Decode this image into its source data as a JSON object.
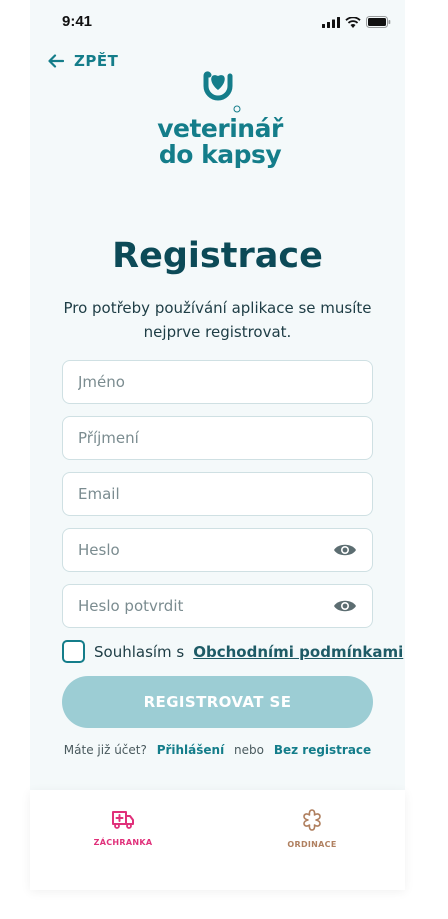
{
  "status_bar": {
    "time": "9:41"
  },
  "nav": {
    "back_label": "ZPĚT"
  },
  "logo": {
    "line1": "veterinář",
    "line2": "do kapsy"
  },
  "header": {
    "title": "Registrace",
    "subtitle": "Pro potřeby používání aplikace se musíte nejprve registrovat."
  },
  "form": {
    "first_name_placeholder": "Jméno",
    "last_name_placeholder": "Příjmení",
    "email_placeholder": "Email",
    "password_placeholder": "Heslo",
    "password_confirm_placeholder": "Heslo potvrdit",
    "consent_prefix": "Souhlasím s",
    "consent_link": "Obchodními podmínkami",
    "submit_label": "REGISTROVAT SE"
  },
  "footer_links": {
    "question": "Máte již účet?",
    "login": "Přihlášení",
    "or": "nebo",
    "no_registration": "Bez registrace"
  },
  "tabs": [
    {
      "label": "ZÁCHRANKA",
      "icon": "ambulance-icon"
    },
    {
      "label": "ORDINACE",
      "icon": "clinic-icon"
    }
  ],
  "colors": {
    "primary": "#147d8a",
    "title": "#0c4a57",
    "button_disabled": "#9ccdd4",
    "tab_active": "#e0307a",
    "tab_inactive": "#b08060"
  }
}
